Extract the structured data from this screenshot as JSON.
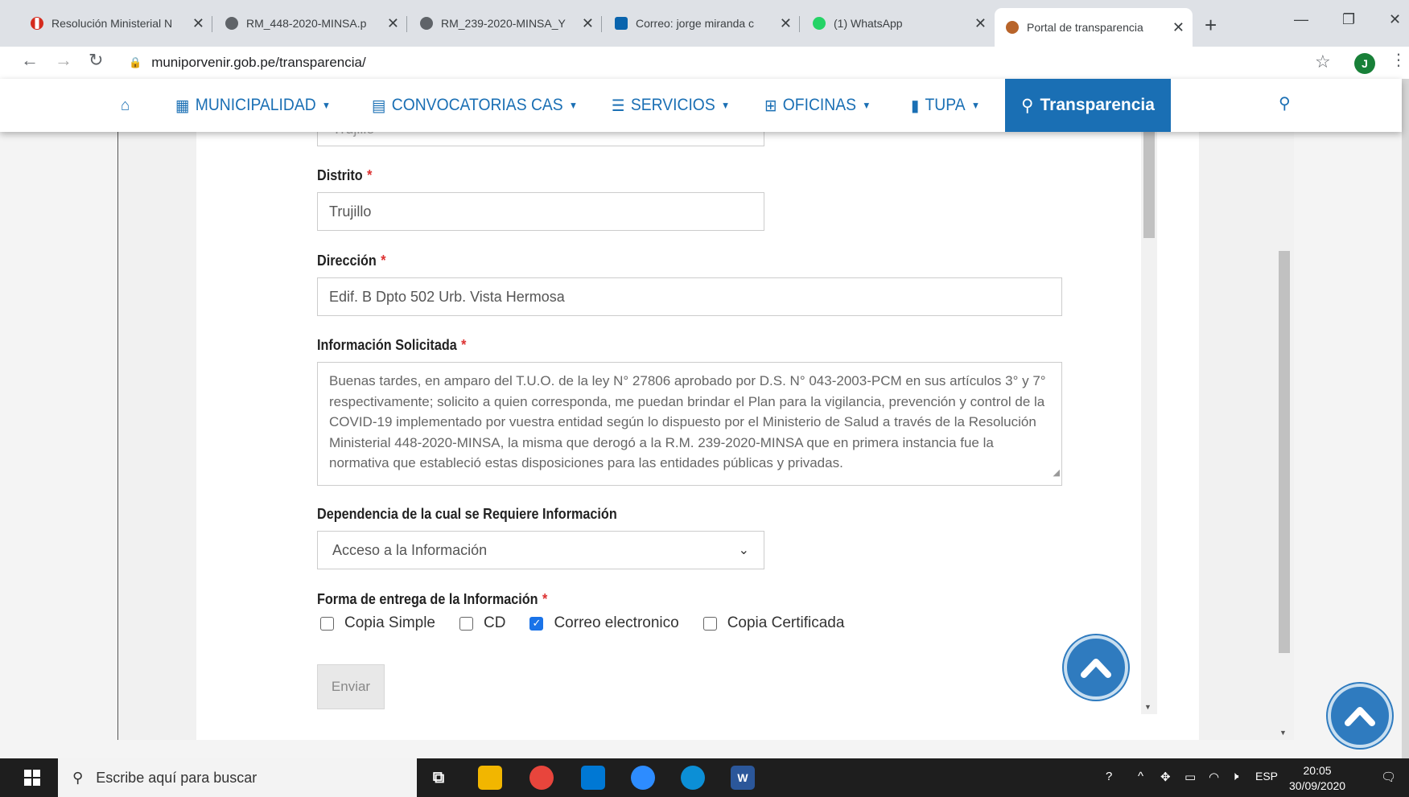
{
  "browser": {
    "tabs": [
      {
        "title": "Resolución Ministerial N",
        "icon": "peru-flag-icon",
        "color": "#d52b1e"
      },
      {
        "title": "RM_448-2020-MINSA.p",
        "icon": "globe-icon",
        "color": "#5f6368"
      },
      {
        "title": "RM_239-2020-MINSA_Y",
        "icon": "globe-icon",
        "color": "#5f6368"
      },
      {
        "title": "Correo: jorge miranda c",
        "icon": "outlook-icon",
        "color": "#0a64ad"
      },
      {
        "title": "(1) WhatsApp",
        "icon": "whatsapp-icon",
        "color": "#25d366"
      },
      {
        "title": "Portal de transparencia",
        "icon": "municipal-seal-icon",
        "color": "#b8642a"
      }
    ],
    "url": "muniporvenir.gob.pe/transparencia/",
    "profile_initial": "J"
  },
  "site_nav": {
    "items": [
      {
        "label": "MUNICIPALIDAD",
        "icon": "building-icon"
      },
      {
        "label": "CONVOCATORIAS CAS",
        "icon": "id-card-icon"
      },
      {
        "label": "SERVICIOS",
        "icon": "list-icon"
      },
      {
        "label": "OFICINAS",
        "icon": "grid-icon"
      },
      {
        "label": "TUPA",
        "icon": "book-icon"
      }
    ],
    "active": "Transparencia",
    "brand_color": "#1a6fb4"
  },
  "form": {
    "previous_value": "Trujillo",
    "distrito": {
      "label": "Distrito",
      "value": "Trujillo"
    },
    "direccion": {
      "label": "Dirección",
      "value": "Edif. B Dpto 502 Urb. Vista Hermosa"
    },
    "informacion": {
      "label": "Información Solicitada",
      "value": "Buenas tardes, en amparo del T.U.O. de la ley N° 27806 aprobado por D.S. N° 043-2003-PCM en sus artículos 3° y 7° respectivamente; solicito a quien corresponda, me puedan brindar el Plan para la vigilancia, prevención y control de la COVID-19 implementado por vuestra entidad según lo dispuesto por el Ministerio de Salud a través de la Resolución Ministerial 448-2020-MINSA, la misma que derogó a la R.M. 239-2020-MINSA que en primera instancia fue la normativa que estableció estas disposiciones para las entidades públicas y privadas."
    },
    "dependencia": {
      "label": "Dependencia de la cual se Requiere Información",
      "selected": "Acceso a la Información"
    },
    "forma_entrega": {
      "label": "Forma de entrega de la Información",
      "options": [
        {
          "label": "Copia Simple",
          "checked": false
        },
        {
          "label": "CD",
          "checked": false
        },
        {
          "label": "Correo electronico",
          "checked": true
        },
        {
          "label": "Copia Certificada",
          "checked": false
        }
      ]
    },
    "required_mark": "*",
    "submit_label": "Enviar"
  },
  "taskbar": {
    "search_placeholder": "Escribe aquí para buscar",
    "lang": "ESP",
    "time": "20:05",
    "date": "30/09/2020"
  }
}
